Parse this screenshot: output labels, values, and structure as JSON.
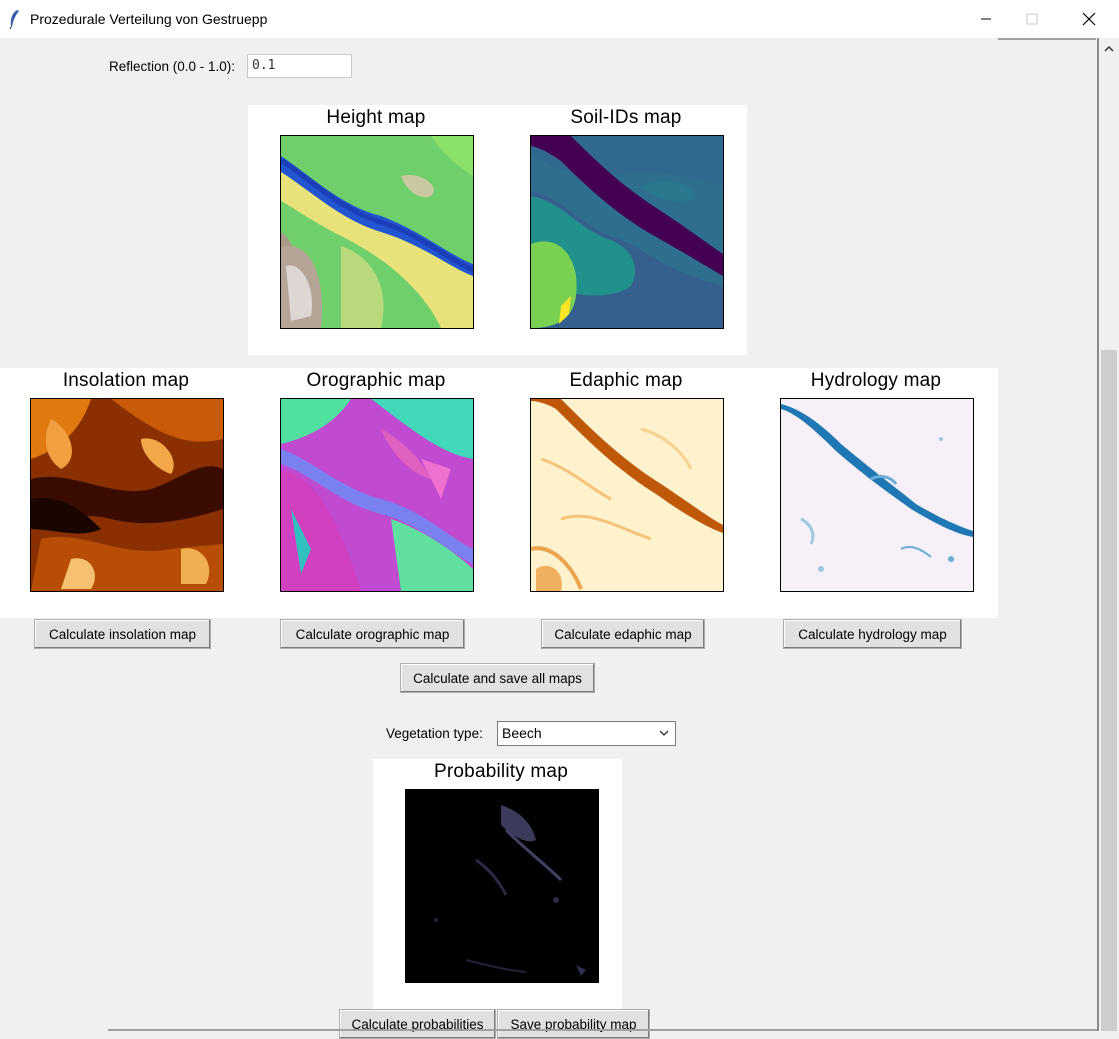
{
  "window": {
    "title": "Prozedurale Verteilung von Gestruepp"
  },
  "reflection": {
    "label": "Reflection (0.0 - 1.0):",
    "value": "0.1"
  },
  "maps": {
    "height": {
      "title": "Height map"
    },
    "soil": {
      "title": "Soil-IDs map"
    },
    "insolation": {
      "title": "Insolation map"
    },
    "orographic": {
      "title": "Orographic map"
    },
    "edaphic": {
      "title": "Edaphic map"
    },
    "hydrology": {
      "title": "Hydrology map"
    },
    "probability": {
      "title": "Probability map"
    }
  },
  "buttons": {
    "calc_insolation": "Calculate insolation map",
    "calc_orographic": "Calculate orographic map",
    "calc_edaphic": "Calculate edaphic map",
    "calc_hydrology": "Calculate hydrology map",
    "calc_save_all": "Calculate and save all maps",
    "calc_probabilities": "Calculate probabilities",
    "save_probability": "Save probability map"
  },
  "vegetation": {
    "label": "Vegetation type:",
    "selected": "Beech"
  },
  "colors": {
    "background": "#f0f0f0",
    "panel": "#ffffff",
    "button": "#e1e1e1"
  }
}
